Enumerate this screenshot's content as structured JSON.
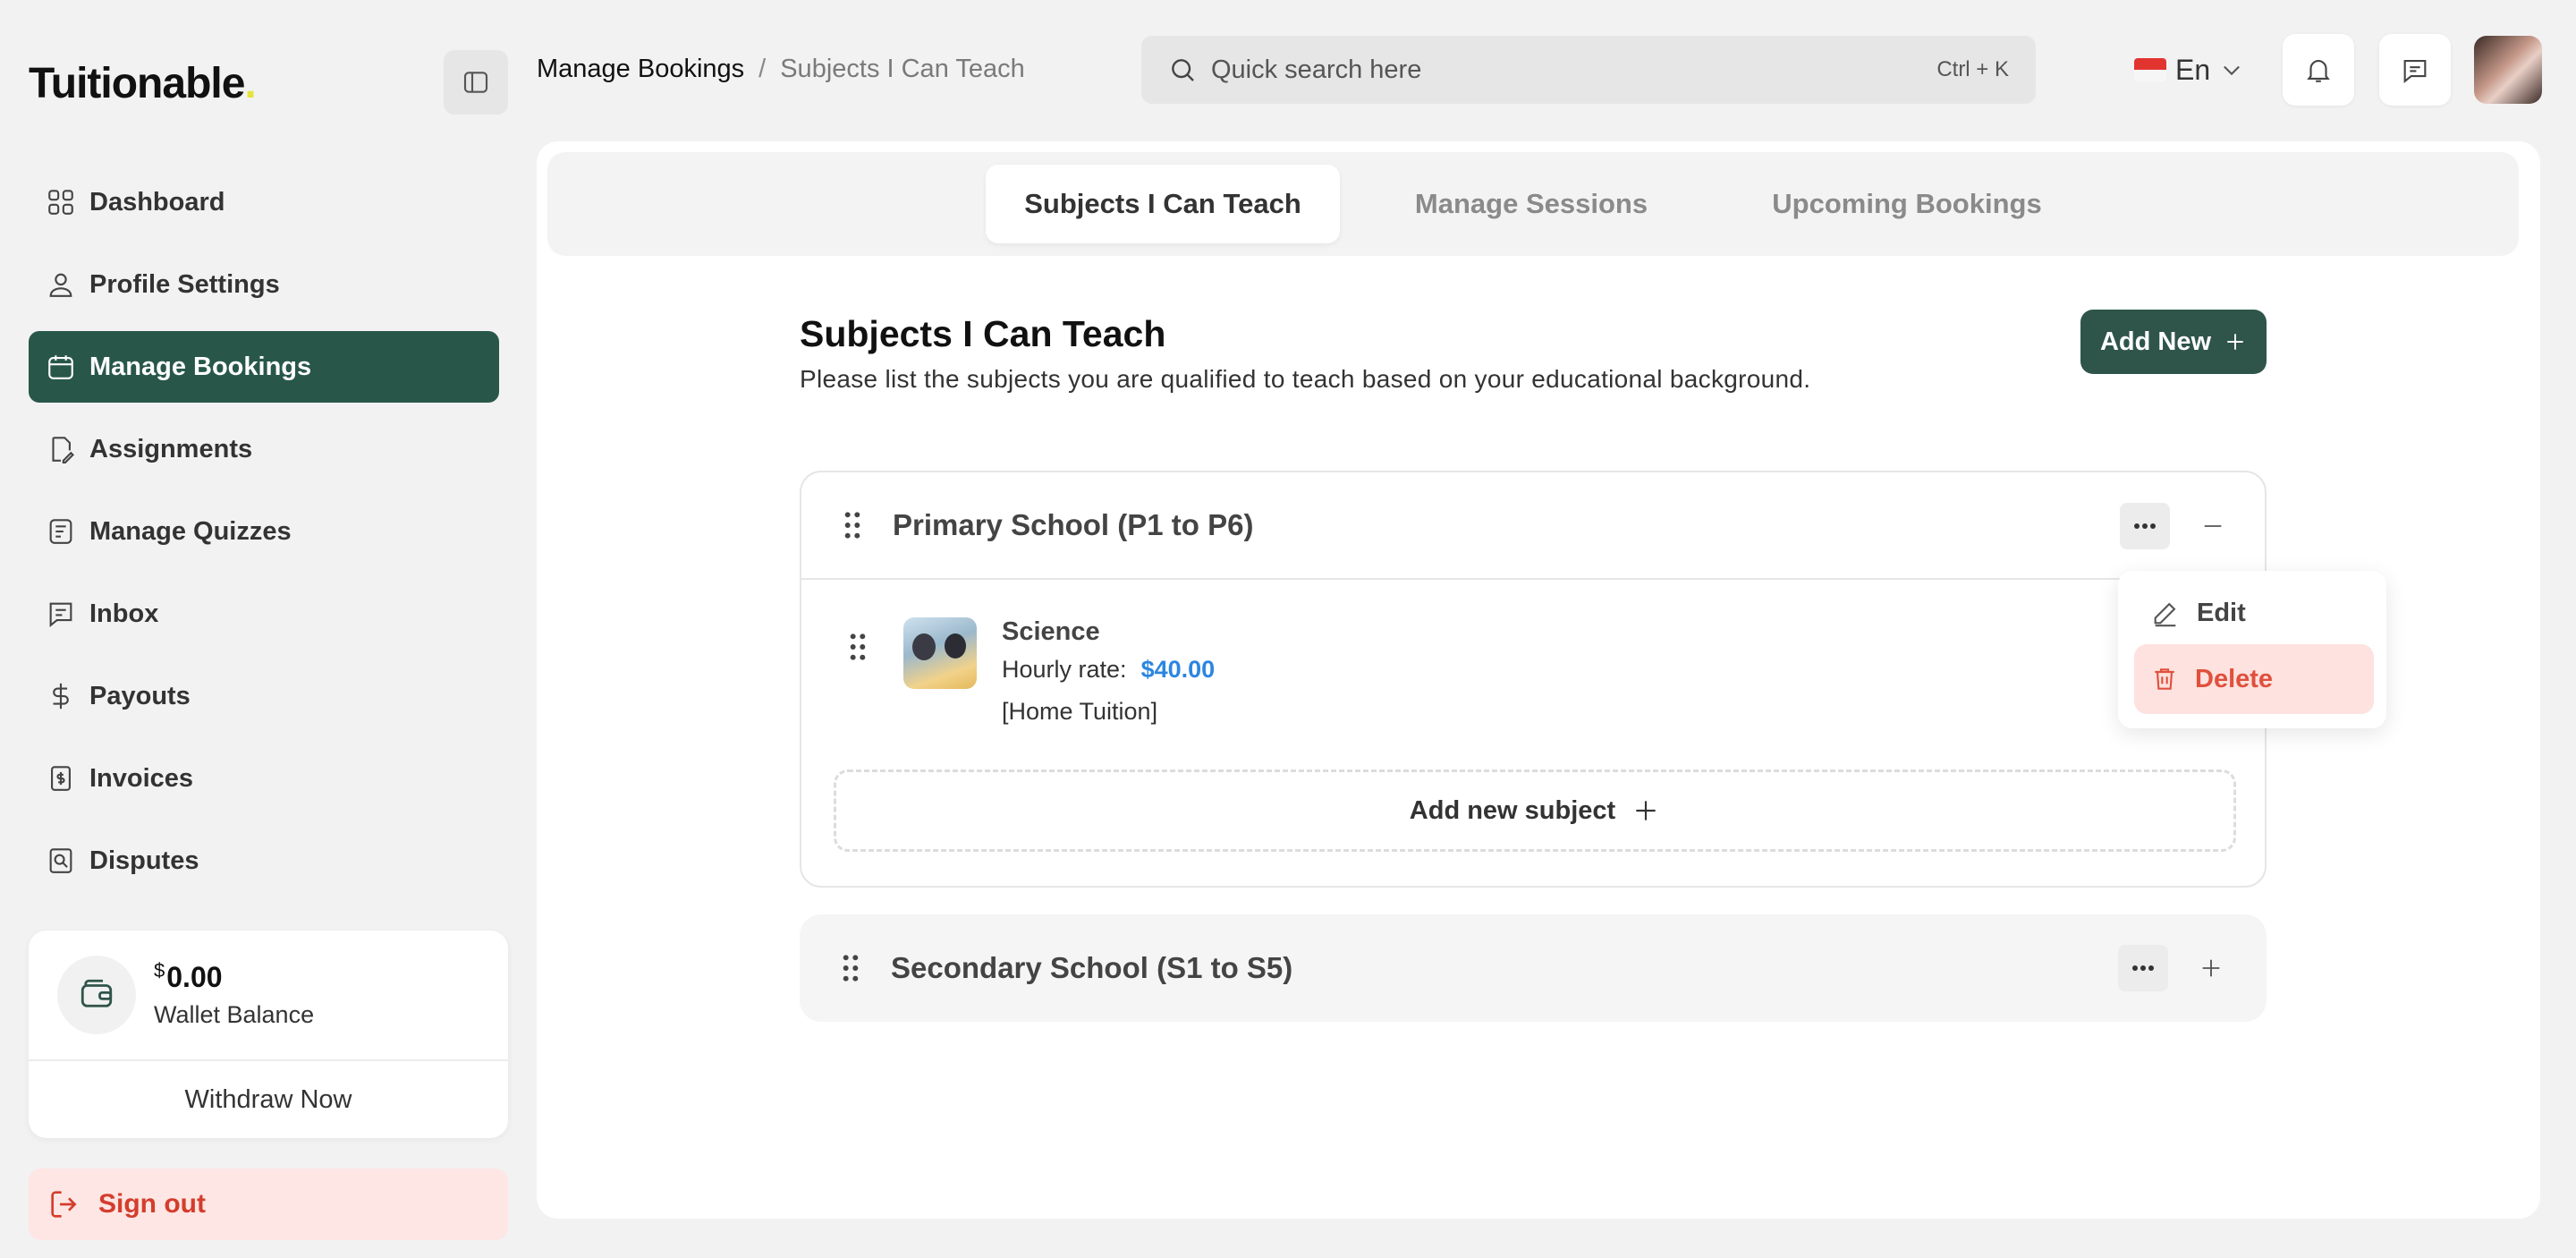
{
  "brand": {
    "name_prefix": "Tuitionable",
    "name_suffix": "."
  },
  "sidebar": {
    "items": [
      {
        "label": "Dashboard",
        "icon": "grid-icon"
      },
      {
        "label": "Profile Settings",
        "icon": "user-icon"
      },
      {
        "label": "Manage Bookings",
        "icon": "calendar-icon",
        "active": true
      },
      {
        "label": "Assignments",
        "icon": "edit-document-icon"
      },
      {
        "label": "Manage Quizzes",
        "icon": "quiz-icon"
      },
      {
        "label": "Inbox",
        "icon": "message-icon"
      },
      {
        "label": "Payouts",
        "icon": "dollar-icon"
      },
      {
        "label": "Invoices",
        "icon": "invoice-icon"
      },
      {
        "label": "Disputes",
        "icon": "dispute-icon"
      }
    ],
    "wallet": {
      "currency": "$",
      "amount": "0.00",
      "label": "Wallet Balance",
      "withdraw_label": "Withdraw Now"
    },
    "signout_label": "Sign out"
  },
  "header": {
    "breadcrumb": {
      "parent": "Manage Bookings",
      "separator": "/",
      "current": "Subjects I Can Teach"
    },
    "search": {
      "placeholder": "Quick search here",
      "shortcut": "Ctrl + K"
    },
    "language": "En"
  },
  "tabs": [
    {
      "label": "Subjects I Can Teach",
      "active": true
    },
    {
      "label": "Manage Sessions"
    },
    {
      "label": "Upcoming Bookings"
    }
  ],
  "main": {
    "title": "Subjects I Can Teach",
    "description": "Please list the subjects you are qualified to teach based on your educational background.",
    "add_new_label": "Add New",
    "groups": [
      {
        "title": "Primary School (P1 to P6)",
        "expanded": true,
        "subjects": [
          {
            "name": "Science",
            "rate_label": "Hourly rate:",
            "rate": "$40.00",
            "mode": "[Home Tuition]"
          }
        ],
        "add_subject_label": "Add new subject"
      },
      {
        "title": "Secondary School (S1 to S5)",
        "expanded": false
      }
    ]
  },
  "dropdown": {
    "edit_label": "Edit",
    "delete_label": "Delete"
  },
  "colors": {
    "primary": "#28574a",
    "accent_rate": "#2b86e0",
    "danger": "#e0503d",
    "danger_bg": "#fde2df"
  }
}
